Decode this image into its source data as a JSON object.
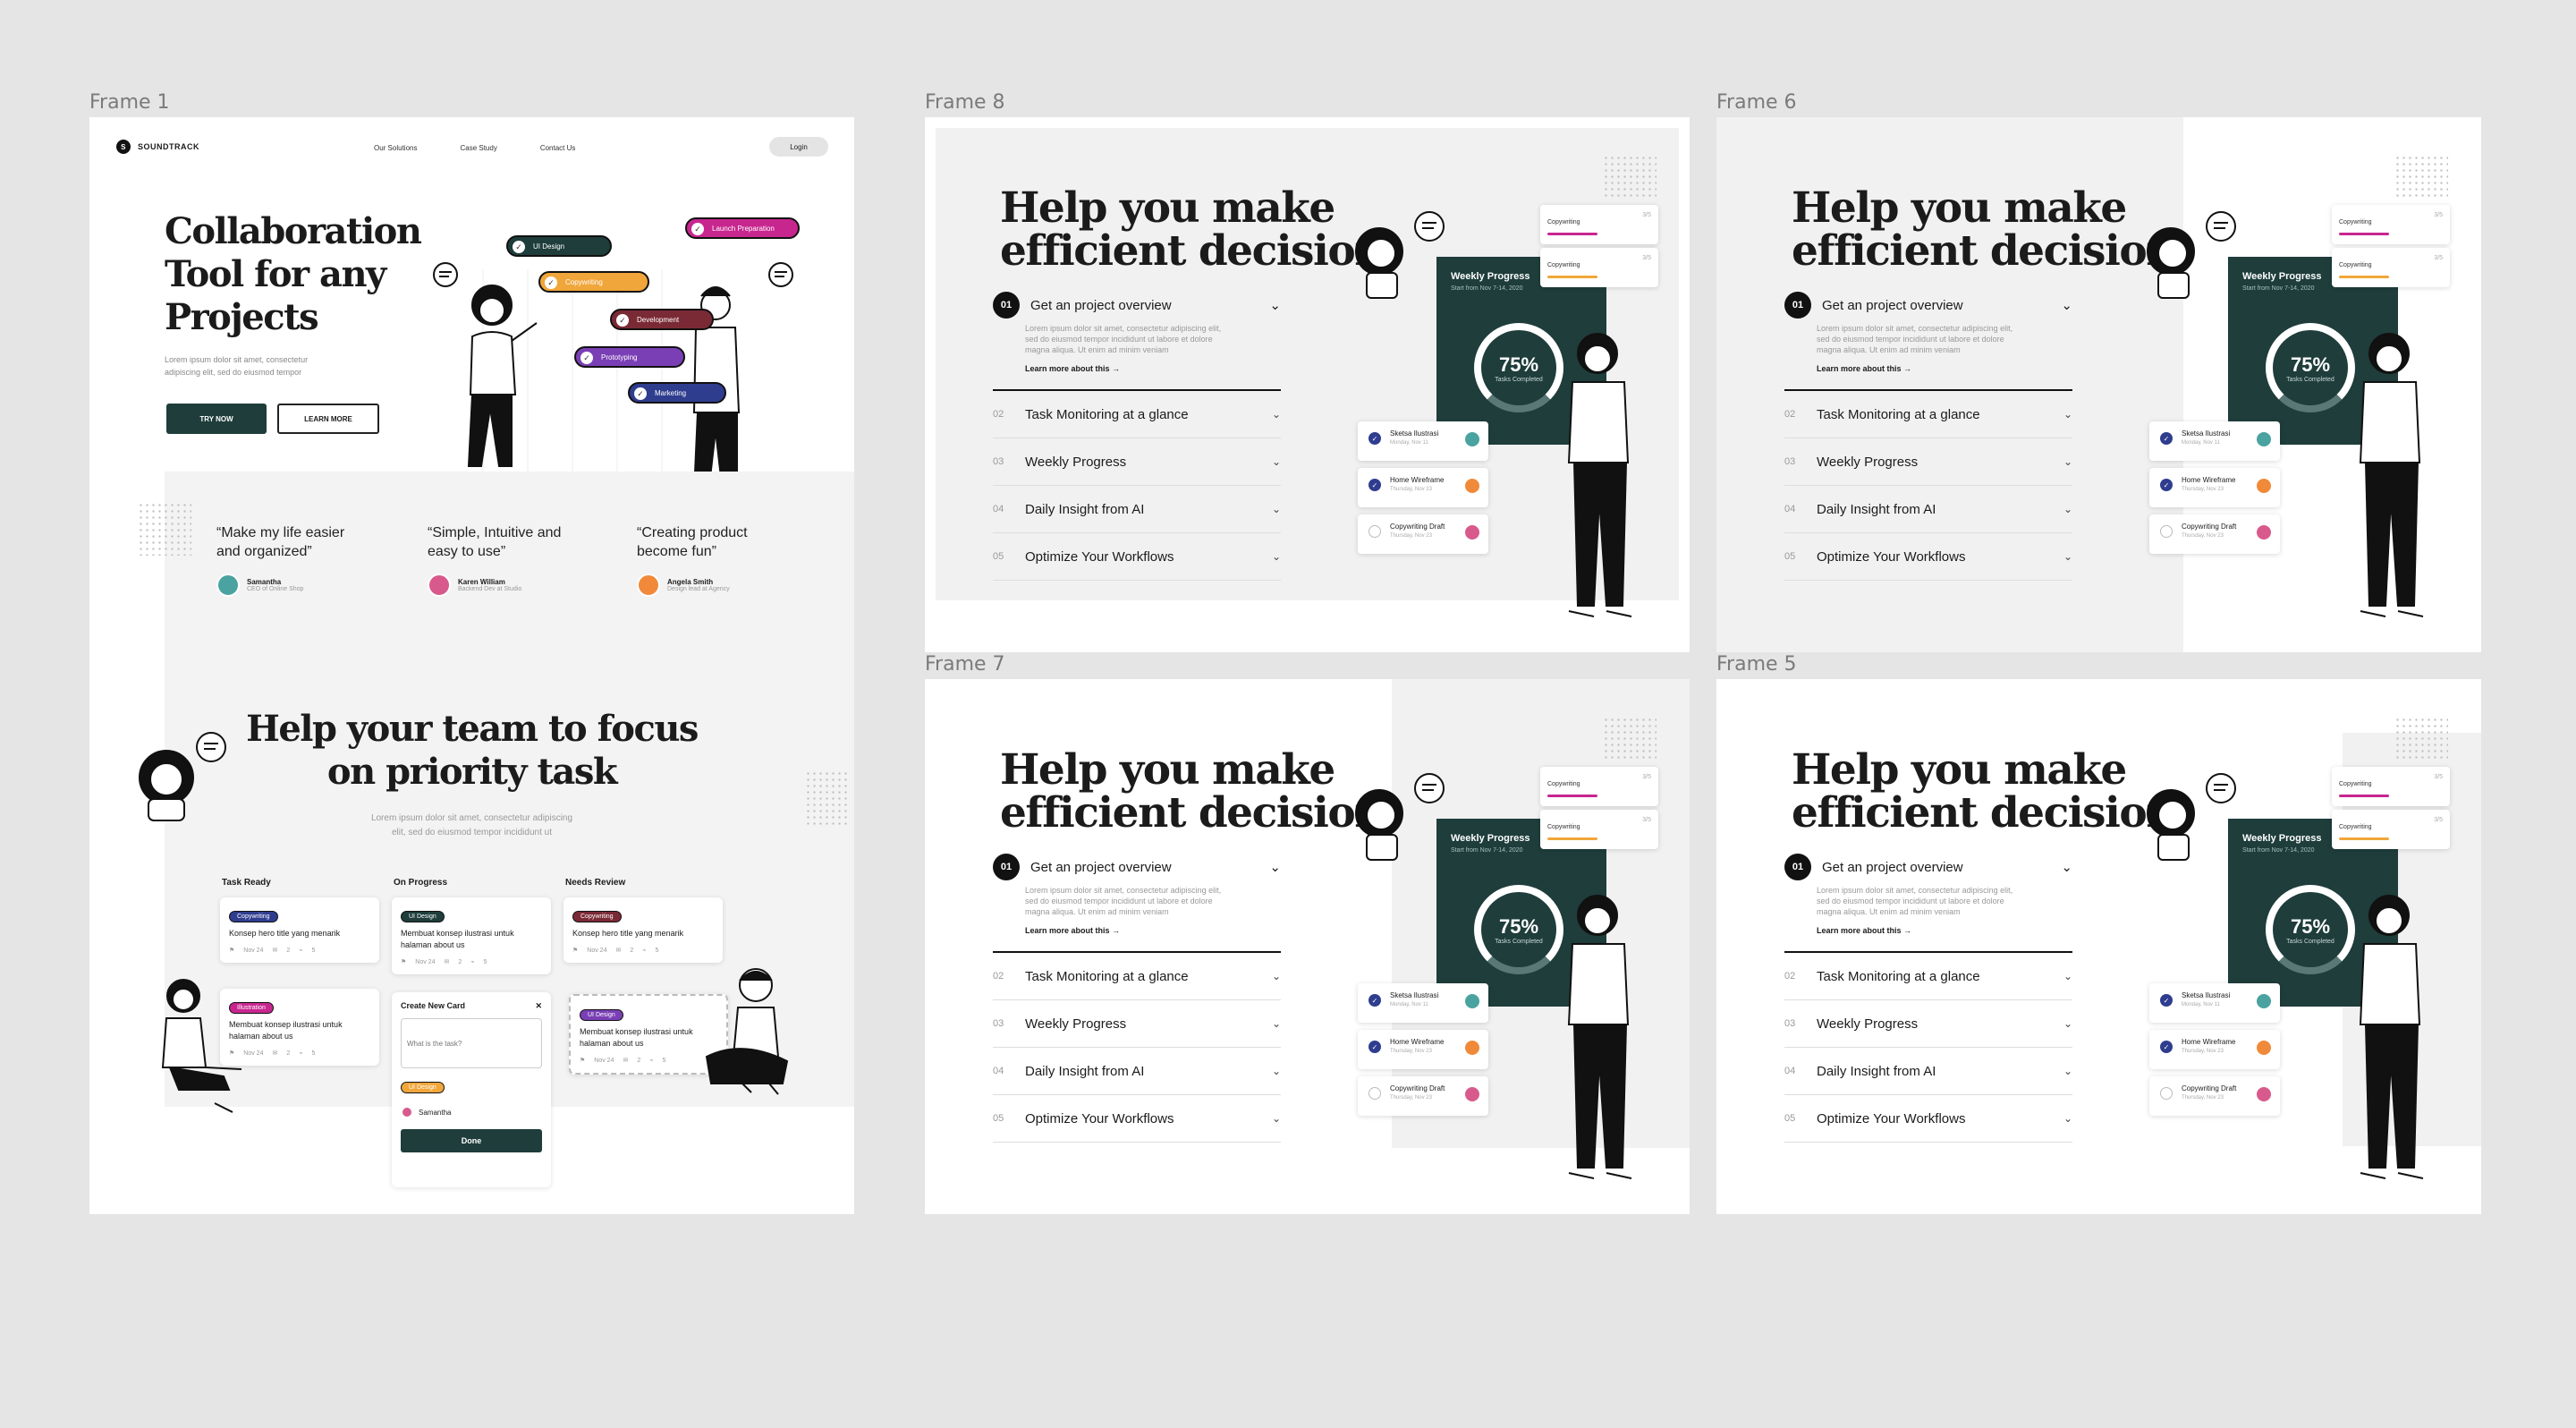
{
  "frames": {
    "f1": "Frame 1",
    "f8": "Frame 8",
    "f6": "Frame 6",
    "f7": "Frame 7",
    "f5": "Frame 5"
  },
  "landing": {
    "brand": "SOUNDTRACK",
    "nav": [
      "Our Solutions",
      "Case Study",
      "Contact Us"
    ],
    "login": "Login",
    "hero_title": [
      "Collaboration",
      "Tool for any",
      "Projects"
    ],
    "hero_desc": [
      "Lorem ipsum dolor sit amet, consectetur",
      "adipiscing elit, sed do eiusmod tempor"
    ],
    "try_now": "TRY NOW",
    "learn_more": "LEARN MORE",
    "pills": [
      {
        "label": "UI Design",
        "color": "#1e3d3b"
      },
      {
        "label": "Copywriting",
        "color": "#f0a63a"
      },
      {
        "label": "Development",
        "color": "#7a2a35"
      },
      {
        "label": "Prototyping",
        "color": "#7a3fb5"
      },
      {
        "label": "Marketing",
        "color": "#2f3d8f"
      },
      {
        "label": "Launch Preparation",
        "color": "#c8268f"
      }
    ],
    "testimonials": [
      {
        "quote": "“Make my life easier and organized”",
        "name": "Samantha",
        "role": "CEO of Online Shop",
        "color": "#4aa3a0"
      },
      {
        "quote": "“Simple, Intuitive and easy to use”",
        "name": "Karen William",
        "role": "Backend Dev at Studio",
        "color": "#d85a8c"
      },
      {
        "quote": "“Creating product become fun”",
        "name": "Angela Smith",
        "role": "Design lead at Agency",
        "color": "#f08a3a"
      }
    ],
    "section_title": [
      "Help your team to focus",
      "on priority task"
    ],
    "section_desc": [
      "Lorem ipsum dolor sit amet, consectetur adipiscing",
      "elit, sed do eiusmod tempor incididunt ut"
    ],
    "board": {
      "columns": [
        "Task Ready",
        "On Progress",
        "Needs Review"
      ],
      "cards": [
        {
          "tag": "Copywriting",
          "color": "#2f3d8f",
          "title": "Konsep hero title yang menarik",
          "date": "Nov 24",
          "c1": "2",
          "c2": "5"
        },
        {
          "tag": "Illustration",
          "color": "#c8268f",
          "title": "Membuat konsep ilustrasi untuk halaman about us",
          "date": "Nov 24",
          "c1": "2",
          "c2": "5"
        },
        {
          "tag": "UI Design",
          "color": "#1e3d3b",
          "title": "Membuat konsep ilustrasi untuk halaman about us",
          "date": "Nov 24",
          "c1": "2",
          "c2": "5"
        },
        {
          "tag": "Copywriting",
          "color": "#7a2a35",
          "title": "Konsep hero title yang menarik",
          "date": "Nov 24",
          "c1": "2",
          "c2": "5"
        },
        {
          "tag": "UI Design",
          "color": "#7a3fb5",
          "title": "Membuat konsep ilustrasi untuk halaman about us",
          "date": "Nov 24",
          "c1": "2",
          "c2": "5"
        }
      ],
      "new_card": {
        "title": "Create New Card",
        "placeholder": "What is the task?",
        "tag": "UI Design",
        "assignee": "Samantha",
        "done": "Done"
      }
    }
  },
  "feature": {
    "title": [
      "Help you make",
      "efficient decision"
    ],
    "open_item": {
      "num": "01",
      "label": "Get an project overview",
      "desc": [
        "Lorem ipsum dolor sit amet, consectetur adipiscing elit,",
        "sed do eiusmod tempor incididunt ut labore et dolore",
        "magna aliqua. Ut enim ad minim veniam"
      ],
      "more": "Learn more about this  →"
    },
    "items": [
      {
        "num": "02",
        "label": "Task Monitoring at a glance"
      },
      {
        "num": "03",
        "label": "Weekly Progress"
      },
      {
        "num": "04",
        "label": "Daily Insight from AI"
      },
      {
        "num": "05",
        "label": "Optimize Your Workflows"
      }
    ],
    "weekly": {
      "title": "Weekly Progress",
      "sub": "Start from Nov 7-14, 2020",
      "percent": "75%",
      "caption": "Tasks Completed"
    },
    "minis": [
      {
        "label": "Copywriting",
        "count": "3/5",
        "color": "#c8268f"
      },
      {
        "label": "Copywriting",
        "count": "3/5",
        "color": "#f0a63a"
      }
    ],
    "tasks": [
      {
        "label": "Sketsa Ilustrasi",
        "date": "Monday, Nov 11",
        "done": true,
        "color": "#4aa3a0"
      },
      {
        "label": "Home Wireframe",
        "date": "Thursday, Nov 23",
        "done": true,
        "color": "#f08a3a"
      },
      {
        "label": "Copywriting Draft",
        "date": "Thursday, Nov 23",
        "done": false,
        "color": "#d85a8c"
      }
    ]
  }
}
